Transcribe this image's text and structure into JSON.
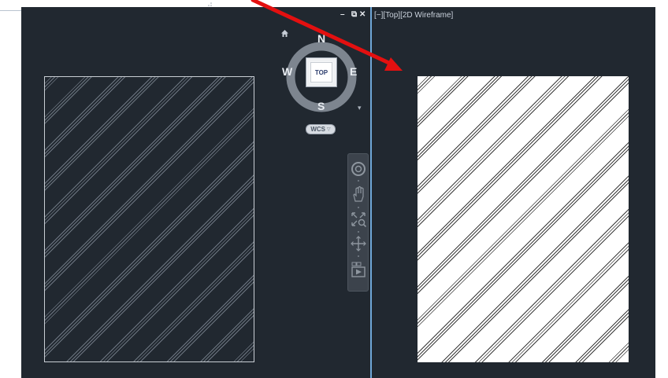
{
  "viewport": {
    "label": "[−][Top][2D Wireframe]"
  },
  "window_controls": {
    "minimize": "–",
    "restore": "⧉",
    "close": "✕"
  },
  "viewcube": {
    "north": "N",
    "south": "S",
    "west": "W",
    "east": "E",
    "face": "TOP",
    "wcs": "WCS",
    "wcs_chevron": "▽",
    "menu": "▾"
  },
  "navigation_bar": {
    "tools": [
      "steering-wheel-icon",
      "pan-icon",
      "zoom-extents-icon",
      "orbit-icon",
      "showmotion-icon"
    ]
  },
  "colors": {
    "canvas": "#212830",
    "divider": "#6fa7d8",
    "arrow": "#e31010",
    "hatch_dark": "#6d7681",
    "hatch_light": "#3b3b3b"
  },
  "icons": [
    "home-icon",
    "minimize-icon",
    "restore-icon",
    "close-icon",
    "palette-grip-icon"
  ]
}
